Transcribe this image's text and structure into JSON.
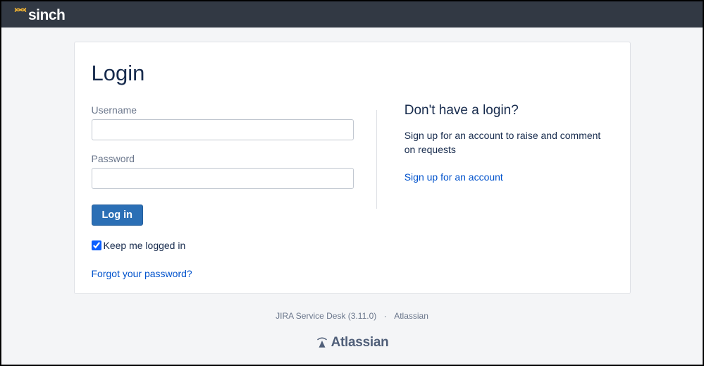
{
  "brand": {
    "name": "sinch"
  },
  "login": {
    "title": "Login",
    "username_label": "Username",
    "username_value": "",
    "password_label": "Password",
    "password_value": "",
    "button_label": "Log in",
    "keep_logged_in_label": "Keep me logged in",
    "keep_logged_in_checked": true,
    "forgot_link": "Forgot your password?"
  },
  "signup": {
    "title": "Don't have a login?",
    "description": "Sign up for an account to raise and comment on requests",
    "link_label": "Sign up for an account"
  },
  "footer": {
    "product": "JIRA Service Desk (3.11.0)",
    "vendor_link": "Atlassian",
    "vendor_logo_text": "Atlassian"
  }
}
